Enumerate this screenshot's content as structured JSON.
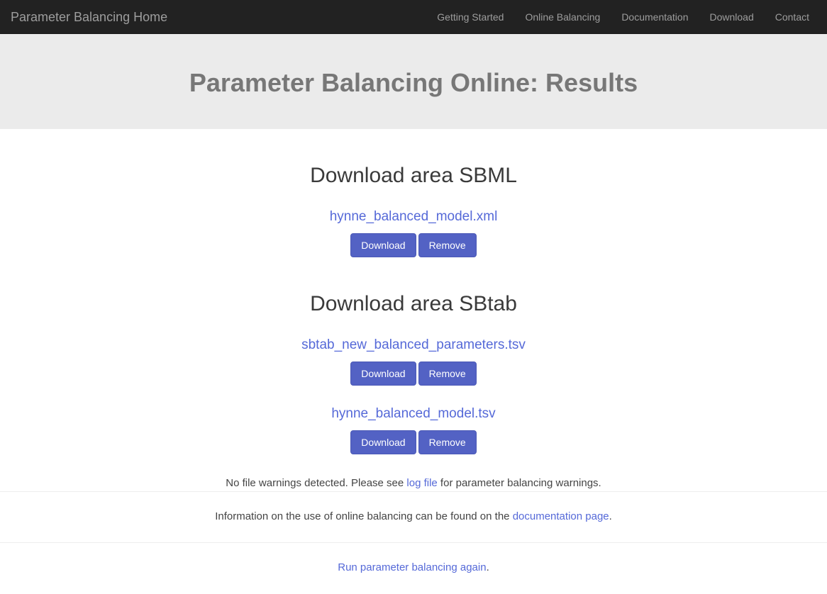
{
  "navbar": {
    "brand": "Parameter Balancing Home",
    "items": [
      {
        "label": "Getting Started"
      },
      {
        "label": "Online Balancing"
      },
      {
        "label": "Documentation"
      },
      {
        "label": "Download"
      },
      {
        "label": "Contact"
      }
    ],
    "colors": {
      "background": "#222222",
      "link": "#9d9d9d"
    }
  },
  "jumbotron": {
    "title": "Parameter Balancing Online: Results",
    "colors": {
      "background": "#ebebeb",
      "text": "#777777"
    }
  },
  "sections": [
    {
      "title": "Download area SBML",
      "files": [
        {
          "name": "hynne_balanced_model.xml",
          "download_label": "Download",
          "remove_label": "Remove"
        }
      ]
    },
    {
      "title": "Download area SBtab",
      "files": [
        {
          "name": "sbtab_new_balanced_parameters.tsv",
          "download_label": "Download",
          "remove_label": "Remove"
        },
        {
          "name": "hynne_balanced_model.tsv",
          "download_label": "Download",
          "remove_label": "Remove"
        }
      ]
    }
  ],
  "warning": {
    "before": "No file warnings detected. Please see ",
    "link": "log file",
    "after": " for parameter balancing warnings."
  },
  "footer": {
    "info_before": "Information on the use of online balancing can be found on the ",
    "info_link": "documentation page",
    "info_after": ".",
    "rerun_link": "Run parameter balancing again",
    "rerun_after": "."
  },
  "colors": {
    "button": "#5362c4",
    "link": "#5569d8",
    "heading": "#3a3a3a",
    "divider": "#eeeeee"
  }
}
